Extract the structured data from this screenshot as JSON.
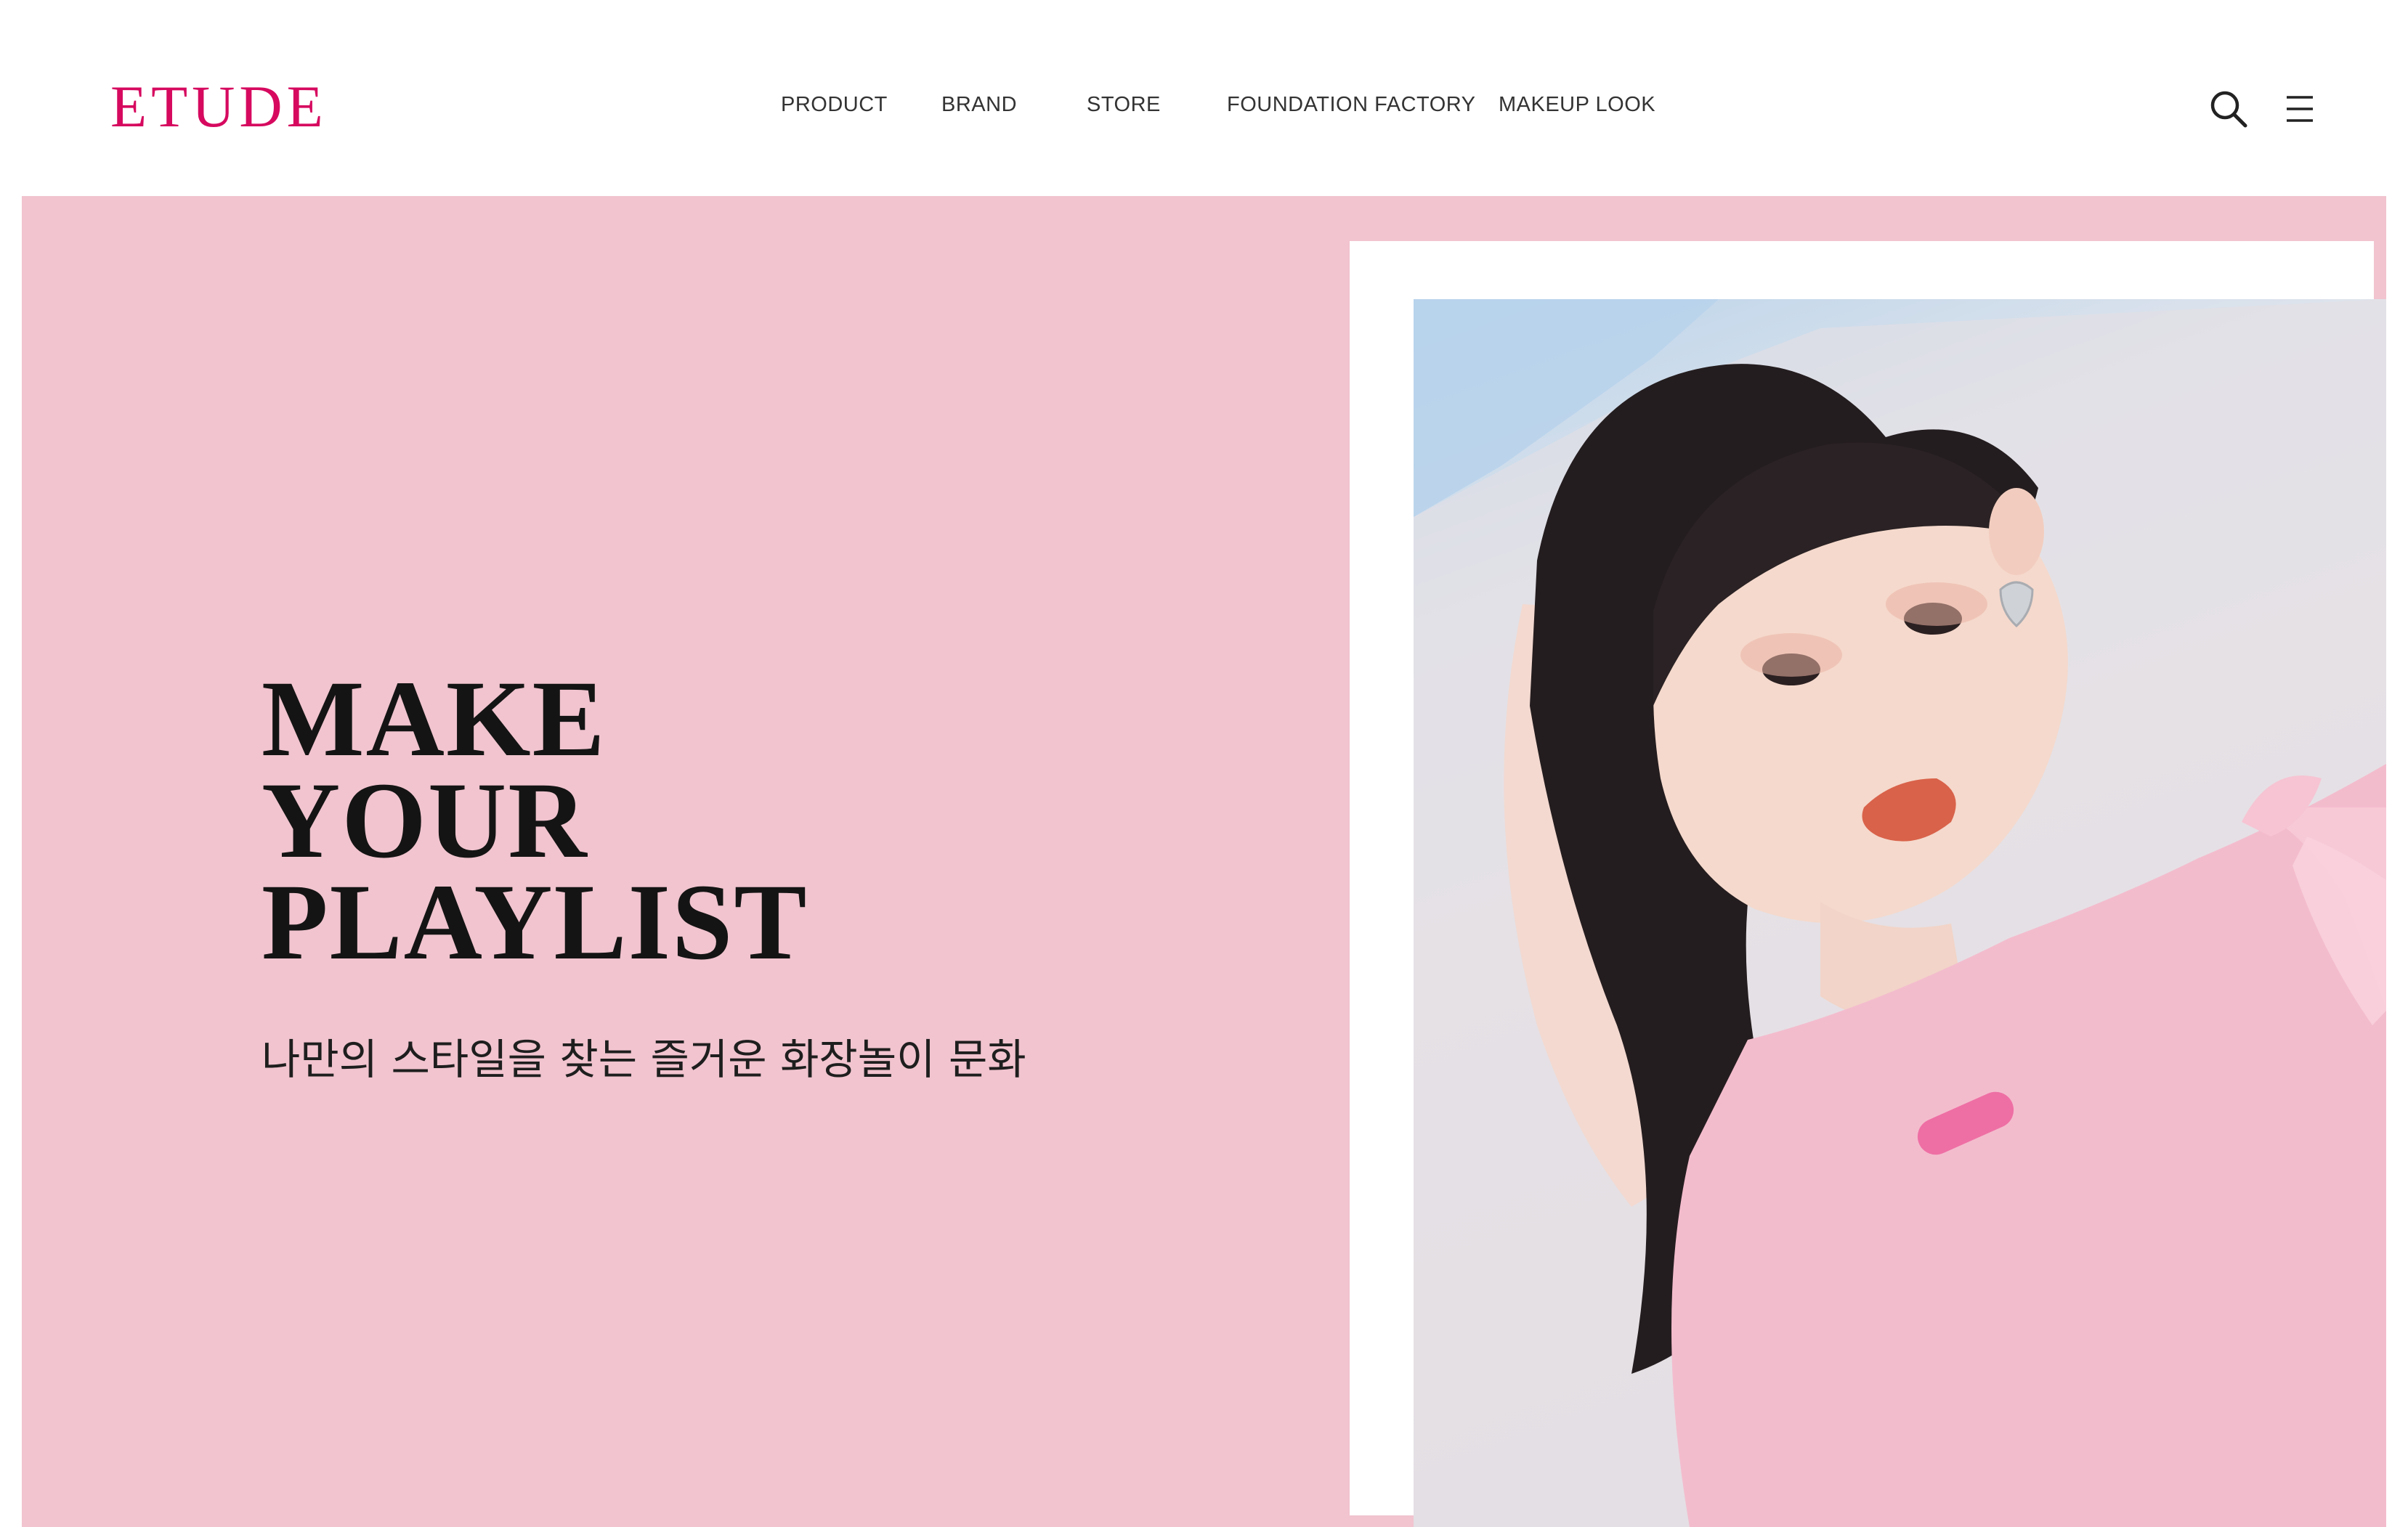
{
  "header": {
    "logo": "ETUDE",
    "nav": [
      {
        "label": "PRODUCT"
      },
      {
        "label": "BRAND"
      },
      {
        "label": "STORE"
      },
      {
        "label": "FOUNDATION FACTORY"
      },
      {
        "label": "MAKEUP LOOK"
      }
    ],
    "icons": {
      "search": "search-icon",
      "menu": "hamburger-menu-icon"
    }
  },
  "hero": {
    "title_lines": [
      "MAKE",
      "YOUR",
      "PLAYLIST"
    ],
    "subtitle": "나만의 스타일을 찾는 즐거운 화장놀이 문화"
  },
  "colors": {
    "brand": "#d6095f",
    "hero_background": "#f1c4cf",
    "text": "#141414"
  }
}
